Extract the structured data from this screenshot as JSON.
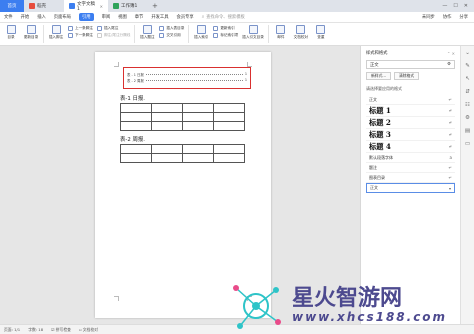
{
  "tabs": [
    {
      "label": "首页"
    },
    {
      "label": "稻壳"
    },
    {
      "label": "文字文稿1"
    },
    {
      "label": "工作簿1"
    }
  ],
  "menu": {
    "file": "文件",
    "items": [
      "开始",
      "插入",
      "页面布局",
      "引用",
      "审阅",
      "视图",
      "章节",
      "开发工具",
      "会员专享"
    ],
    "active": "引用",
    "search": "查找命令、搜索模板",
    "right": [
      "未同步",
      "协作",
      "分享"
    ]
  },
  "ribbon": {
    "toc": "目录",
    "update_toc": "更新目录",
    "insert_footnote": "插入脚注",
    "prev_footnote": "上一条脚注",
    "next_footnote": "下一条脚注",
    "insert_endnote": "插入尾注",
    "footnote_endnote_sep": "脚注/尾注分隔线",
    "insert_caption": "插入题注",
    "insert_crossref": "交叉引用",
    "insert_index": "插入索引",
    "update_index": "更新索引",
    "mark_index": "标记索引项",
    "insert_toa": "插入引文目录",
    "insert_footnote_2": "插入表目录",
    "mailing": "邮件",
    "doc_comparison": "文档校对",
    "thesis_check": "查重"
  },
  "document": {
    "toc_lines": [
      {
        "label": "表 - 1 日报",
        "page": "1"
      },
      {
        "label": "表 - 2 周报",
        "page": "1"
      }
    ],
    "heading1": "表-1 日报.",
    "heading2": "表-2 周报."
  },
  "panel": {
    "title": "样式和格式",
    "current_style": "正文",
    "new_style": "新样式...",
    "clear_format": "清除格式",
    "select_label": "请选择要应用的格式",
    "styles": [
      {
        "label": "正文",
        "kind": "s"
      },
      {
        "label": "标题 1",
        "kind": "h"
      },
      {
        "label": "标题 2",
        "kind": "h"
      },
      {
        "label": "标题 3",
        "kind": "h"
      },
      {
        "label": "标题 4",
        "kind": "h"
      },
      {
        "label": "默认段落字体",
        "kind": "s"
      },
      {
        "label": "题注",
        "kind": "s"
      },
      {
        "label": "图表目录",
        "kind": "s"
      },
      {
        "label": "正文",
        "kind": "s",
        "selected": true
      }
    ]
  },
  "statusbar": {
    "page": "页面: 1/1",
    "words": "字数: 18",
    "spell": "拼写检查",
    "doc_check": "文档校对"
  },
  "watermark": {
    "text": "星火智游网",
    "url": "www.xhcs188.com"
  },
  "colors": {
    "accent": "#3c7ef0",
    "highlight_border": "#d9302f",
    "watermark": "#4d4a8f"
  }
}
